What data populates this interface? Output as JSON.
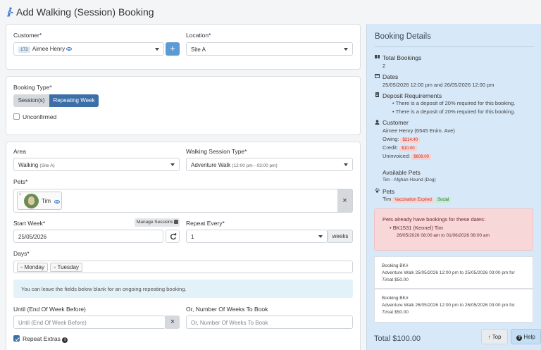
{
  "page": {
    "title": "Add Walking (Session) Booking"
  },
  "customer_section": {
    "customer_label": "Customer*",
    "customer_id": "172",
    "customer_name": "Aimee Henry",
    "location_label": "Location*",
    "location_value": "Site A"
  },
  "booking_type": {
    "label": "Booking Type*",
    "options": [
      "Session(s)",
      "Repeating Week"
    ],
    "selected": "Repeating Week",
    "unconfirmed_label": "Unconfirmed"
  },
  "details": {
    "area_label": "Area",
    "area_value": "Walking",
    "area_site": "(Site A)",
    "session_type_label": "Walking Session Type*",
    "session_type_value": "Adventure Walk",
    "session_type_time": "(12:00 pm - 03:00 pm)",
    "pets_label": "Pets*",
    "pet_name": "Tim",
    "start_week_label": "Start Week*",
    "manage_sessions_label": "Manage Sessions",
    "start_week_value": "25/05/2026",
    "repeat_every_label": "Repeat Every*",
    "repeat_every_value": "1",
    "repeat_unit": "weeks",
    "days_label": "Days*",
    "days": [
      "Monday",
      "Tuesday"
    ],
    "info_text": "You can leave the fields below blank for an ongoing repeating booking.",
    "until_label": "Until (End Of Week Before)",
    "until_placeholder": "Until (End Of Week Before)",
    "num_weeks_label": "Or, Number Of Weeks To Book",
    "num_weeks_placeholder": "Or, Number Of Weeks To Book",
    "repeat_extras_label": "Repeat Extras"
  },
  "sidebar": {
    "title": "Booking Details",
    "total_bookings_label": "Total Bookings",
    "total_bookings_value": "2",
    "dates_label": "Dates",
    "dates_value": "25/05/2026 12:00 pm and 26/05/2026 12:00 pm",
    "deposit_label": "Deposit Requirements",
    "deposit_items": [
      "There is a deposit of 20% required for this booking.",
      "There is a deposit of 20% required for this booking."
    ],
    "customer_label": "Customer",
    "customer_line": "Aimee Henry (6545 Enim. Ave)",
    "owing_label": "Owing:",
    "owing_value": "$214.40",
    "credit_label": "Credit:",
    "credit_value": "$10.00",
    "uninvoiced_label": "Uninvoiced:",
    "uninvoiced_value": "$608.00",
    "available_pets_label": "Available Pets",
    "available_pets_value": "Tim - Afghan Hound (Dog)",
    "pets_label": "Pets",
    "pet_name": "Tim",
    "vaccination_badge": "Vaccination Expired",
    "social_badge": "Social",
    "alert_title": "Pets already have bookings for these dates:",
    "alert_booking": "BK1531 (Kennel) Tim",
    "alert_dates": "26/05/2026 08:00 am to 01/06/2026 08:00 am",
    "bookings": [
      {
        "title": "Booking BK#",
        "line1": "Adventure Walk 25/05/2026 12:00 pm to 25/05/2026 03:00 pm for",
        "pet": "Tim",
        "price": "at $50.00"
      },
      {
        "title": "Booking BK#",
        "line1": "Adventure Walk 26/05/2026 12:00 pm to 26/05/2026 03:00 pm for",
        "pet": "Tim",
        "price": "at $50.00"
      }
    ],
    "total": "Total $100.00"
  },
  "floating": {
    "top_label": "Top",
    "help_label": "Help"
  },
  "colors": {
    "primary": "#3c6fa8",
    "sidebar_bg": "#d7e8f8",
    "alert_bg": "#f8d7d9"
  }
}
